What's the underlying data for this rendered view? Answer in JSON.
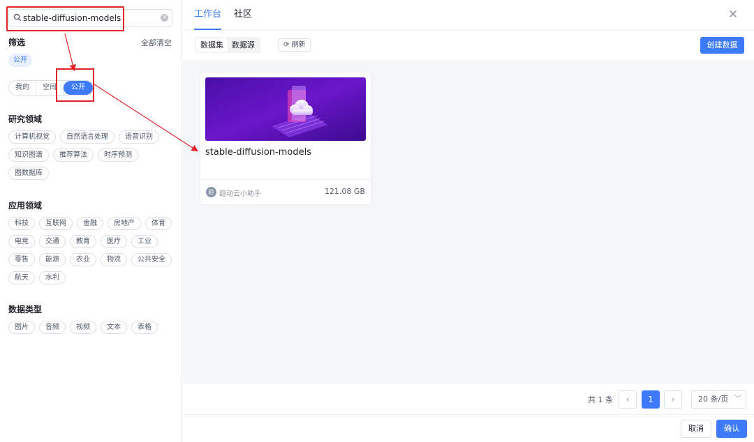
{
  "search": {
    "value": "stable-diffusion-models",
    "clear_icon": "clear-circle-icon"
  },
  "filter": {
    "title": "筛选",
    "clear_all": "全部清空",
    "selected": "公开",
    "scope": [
      "我的",
      "空间",
      "公开"
    ],
    "scope_active": "公开"
  },
  "sections": [
    {
      "title": "研究领域",
      "tags": [
        "计算机视觉",
        "自然语言处理",
        "语音识别",
        "知识图谱",
        "推荐算法",
        "时序预测",
        "图数据库"
      ]
    },
    {
      "title": "应用领域",
      "tags": [
        "科技",
        "互联网",
        "金融",
        "房地产",
        "体育",
        "电竞",
        "交通",
        "教育",
        "医疗",
        "工业",
        "零售",
        "能源",
        "农业",
        "物流",
        "公共安全",
        "航天",
        "水利"
      ]
    },
    {
      "title": "数据类型",
      "tags": [
        "图片",
        "音频",
        "视频",
        "文本",
        "表格"
      ]
    }
  ],
  "tabs": [
    "工作台",
    "社区"
  ],
  "subtabs": [
    "数据集",
    "数据源"
  ],
  "refresh_label": "刷新",
  "create_label": "创建数据",
  "card": {
    "title": "stable-diffusion-models",
    "avatar_char": "趋",
    "author": "趋动云小助手",
    "size": "121.08 GB"
  },
  "pagination": {
    "total": "共 1 条",
    "prev": "‹",
    "current": "1",
    "next": "›",
    "page_size": "20 条/页"
  },
  "footer": {
    "cancel": "取消",
    "confirm": "确认"
  },
  "colors": {
    "primary": "#3e7bfa",
    "highlight": "#e0242a"
  }
}
